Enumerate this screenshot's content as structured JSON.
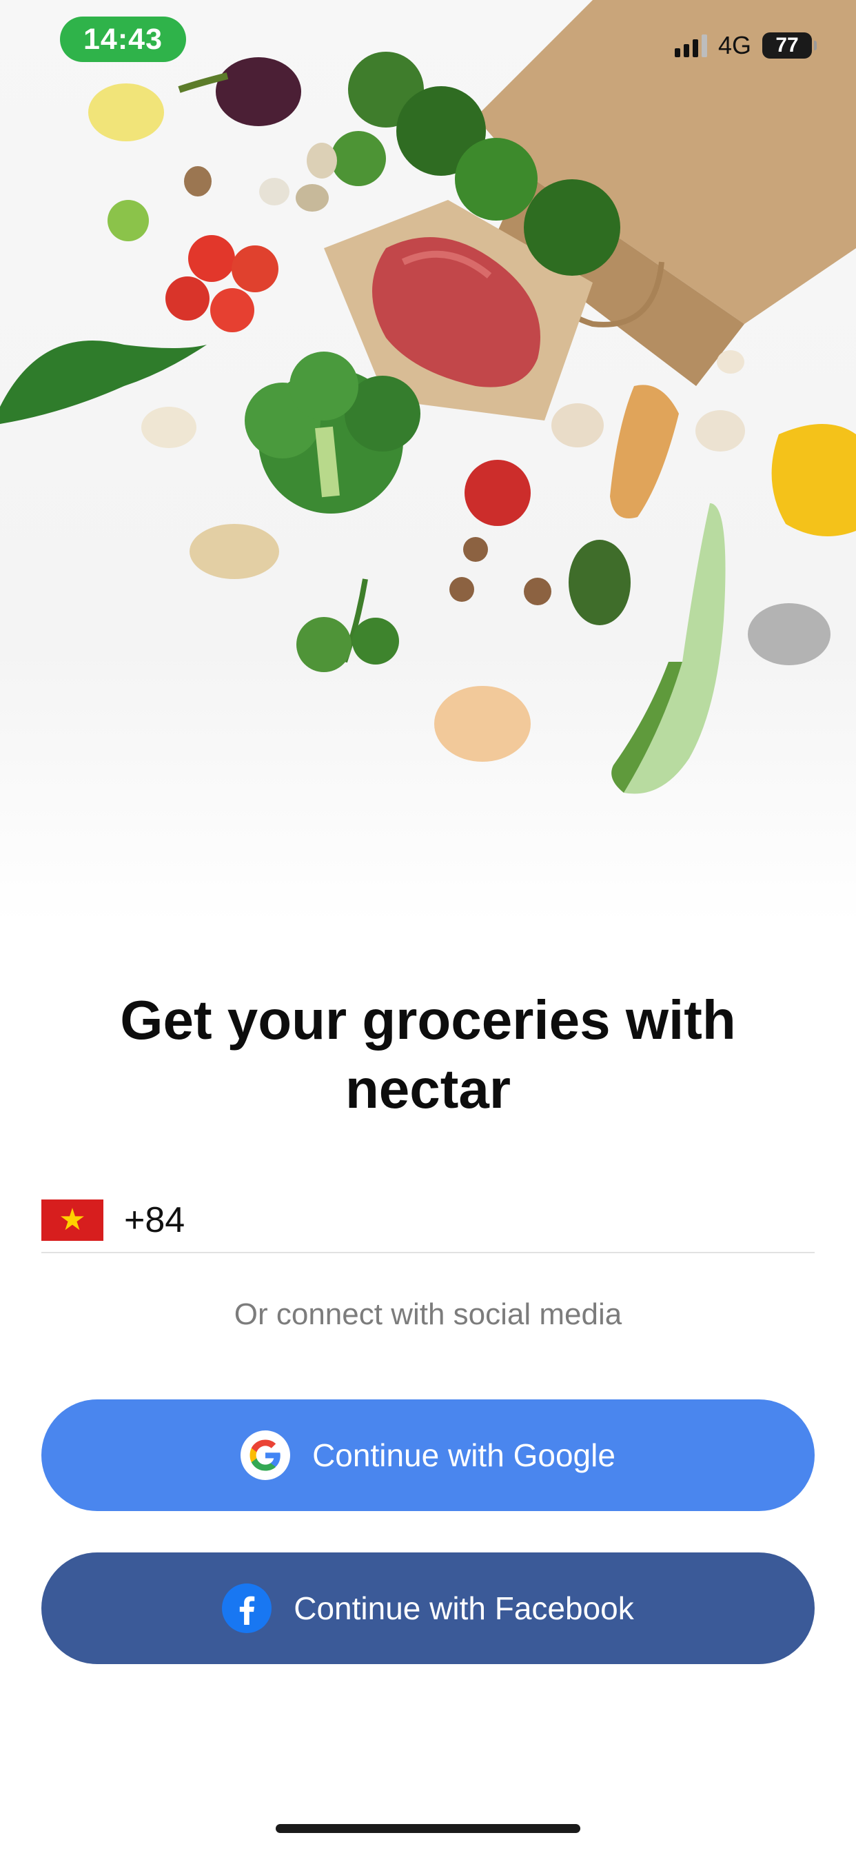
{
  "status_bar": {
    "time": "14:43",
    "network": "4G",
    "battery": "77"
  },
  "hero": {
    "illustration": "groceries-spilling-from-paper-bag"
  },
  "onboarding": {
    "title": "Get your groceries with nectar"
  },
  "phone_input": {
    "country_flag": "vietnam-flag-icon",
    "dial_code": "+84"
  },
  "social": {
    "caption": "Or connect with social media",
    "google_label": "Continue with Google",
    "facebook_label": "Continue with Facebook"
  },
  "colors": {
    "status_pill": "#2fb34a",
    "google_button": "#4a86ee",
    "facebook_button": "#3b5a98",
    "flag_red": "#d71e1e",
    "flag_star": "#ffd200"
  }
}
